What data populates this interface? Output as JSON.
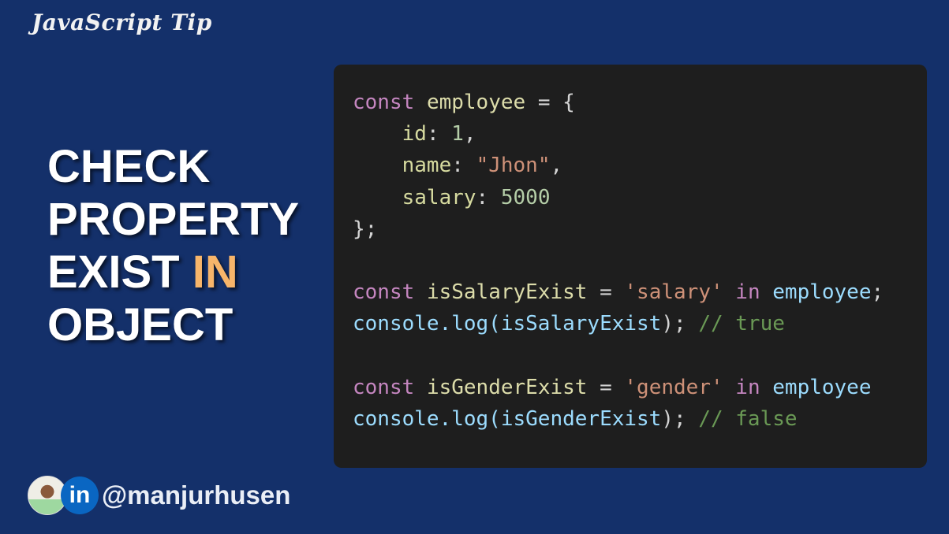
{
  "header": {
    "tip_label": "JavaScript Tip"
  },
  "headline": {
    "lines": [
      "CHECK",
      "PROPERTY",
      "EXIST"
    ],
    "highlight": "IN",
    "last": "OBJECT",
    "highlight_color": "#f7b56a"
  },
  "code": {
    "colors": {
      "kw": "#c586c0",
      "var": "#dcdcaa",
      "prop": "#d7dba0",
      "num": "#b5cea8",
      "str": "#ce9178",
      "op": "#d4d4d4",
      "id": "#9cdcfe",
      "cm": "#6a9955"
    },
    "lines": [
      [
        [
          "kw",
          "const"
        ],
        [
          "op",
          " "
        ],
        [
          "var",
          "employee"
        ],
        [
          "op",
          " = {"
        ]
      ],
      [
        [
          "op",
          "    "
        ],
        [
          "prop",
          "id"
        ],
        [
          "op",
          ": "
        ],
        [
          "num",
          "1"
        ],
        [
          "op",
          ","
        ]
      ],
      [
        [
          "op",
          "    "
        ],
        [
          "prop",
          "name"
        ],
        [
          "op",
          ": "
        ],
        [
          "str",
          "\"Jhon\""
        ],
        [
          "op",
          ","
        ]
      ],
      [
        [
          "op",
          "    "
        ],
        [
          "prop",
          "salary"
        ],
        [
          "op",
          ": "
        ],
        [
          "num",
          "5000"
        ]
      ],
      [
        [
          "op",
          "};"
        ]
      ],
      [],
      [
        [
          "kw",
          "const"
        ],
        [
          "op",
          " "
        ],
        [
          "var",
          "isSalaryExist"
        ],
        [
          "op",
          " = "
        ],
        [
          "str",
          "'salary'"
        ],
        [
          "op",
          " "
        ],
        [
          "kw",
          "in"
        ],
        [
          "op",
          " "
        ],
        [
          "id",
          "employee"
        ],
        [
          "op",
          ";"
        ]
      ],
      [
        [
          "id",
          "console.log("
        ],
        [
          "id",
          "isSalaryExist"
        ],
        [
          "op",
          ");"
        ],
        [
          "op",
          " "
        ],
        [
          "cm",
          "// true"
        ]
      ],
      [],
      [
        [
          "kw",
          "const"
        ],
        [
          "op",
          " "
        ],
        [
          "var",
          "isGenderExist"
        ],
        [
          "op",
          " = "
        ],
        [
          "str",
          "'gender'"
        ],
        [
          "op",
          " "
        ],
        [
          "kw",
          "in"
        ],
        [
          "op",
          " "
        ],
        [
          "id",
          "employee"
        ]
      ],
      [
        [
          "id",
          "console.log("
        ],
        [
          "id",
          "isGenderExist"
        ],
        [
          "op",
          ");"
        ],
        [
          "op",
          " "
        ],
        [
          "cm",
          "// false"
        ]
      ]
    ]
  },
  "footer": {
    "linkedin_icon": "in",
    "handle": "@manjurhusen"
  }
}
